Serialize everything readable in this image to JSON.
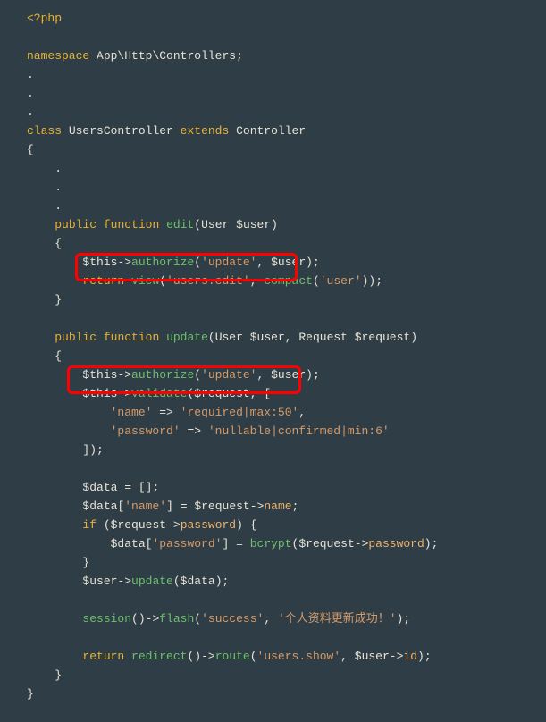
{
  "code": {
    "open_tag": "<?php",
    "ns_kw": "namespace",
    "ns_path": "App\\Http\\Controllers",
    "dot": ".",
    "class_kw": "class",
    "class_name": "UsersController",
    "extends_kw": "extends",
    "parent": "Controller",
    "public_kw": "public",
    "function_kw": "function",
    "fn_edit": "edit",
    "fn_update": "update",
    "type_user": "User",
    "type_request": "Request",
    "var_user": "$user",
    "var_request": "$request",
    "var_this": "$this",
    "var_data": "$data",
    "m_authorize": "authorize",
    "m_validate": "validate",
    "m_view": "view",
    "m_compact": "compact",
    "m_update": "update",
    "m_session": "session",
    "m_flash": "flash",
    "m_redirect": "redirect",
    "m_route": "route",
    "m_bcrypt": "bcrypt",
    "return_kw": "return",
    "if_kw": "if",
    "prop_name": "name",
    "prop_password": "password",
    "prop_id": "id",
    "s_update": "'update'",
    "s_users_edit": "'users.edit'",
    "s_user": "'user'",
    "s_name_key": "'name'",
    "s_name_rule": "'required|max:50'",
    "s_password_key": "'password'",
    "s_password_rule": "'nullable|confirmed|min:6'",
    "s_success": "'success'",
    "s_success_msg": "'个人资料更新成功！'",
    "s_users_show": "'users.show'",
    "arrow": "->",
    "fat_arrow": "=>",
    "lbrace": "{",
    "rbrace": "}",
    "lparen": "(",
    "rparen": ")",
    "lbrack": "[",
    "rbrack": "]",
    "semi": ";",
    "comma": ",",
    "eq": "=",
    "empty_arr": "[]"
  }
}
